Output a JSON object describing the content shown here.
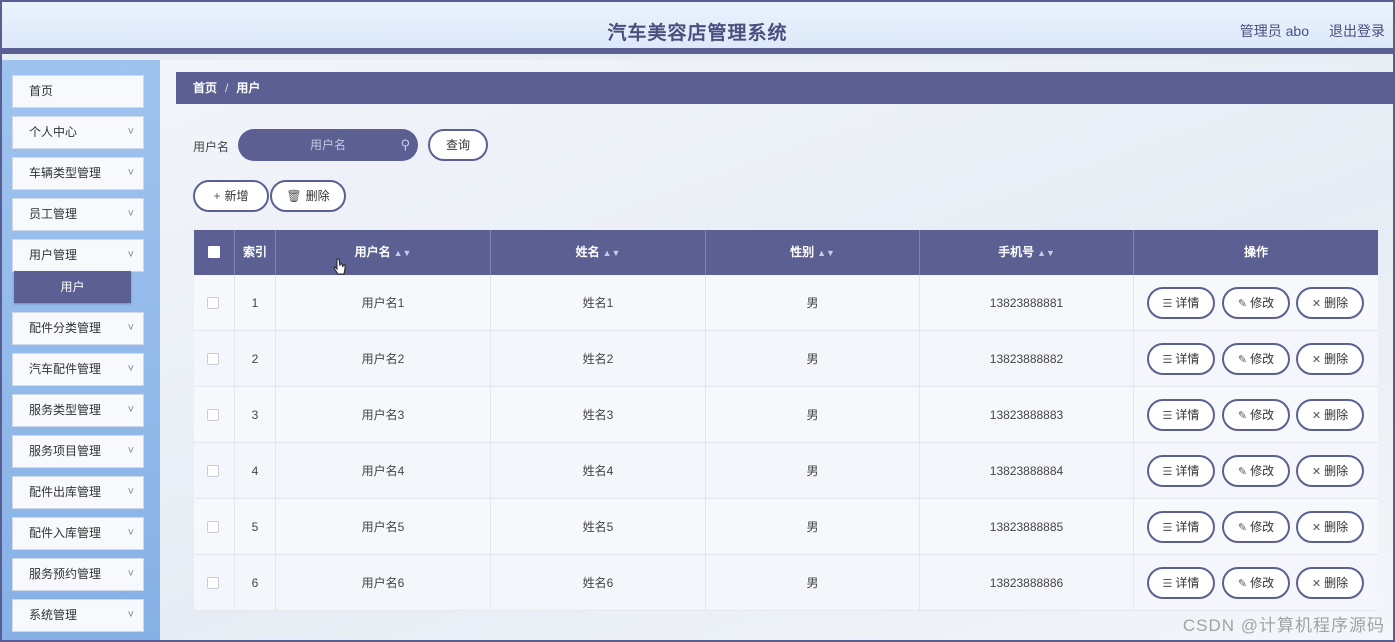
{
  "header": {
    "title": "汽车美容店管理系统",
    "user": "管理员 abo",
    "logout": "退出登录"
  },
  "sidebar": {
    "items": [
      {
        "label": "首页",
        "has_children": false
      },
      {
        "label": "个人中心",
        "has_children": true
      },
      {
        "label": "车辆类型管理",
        "has_children": true
      },
      {
        "label": "员工管理",
        "has_children": true
      },
      {
        "label": "用户管理",
        "has_children": true,
        "expanded": true
      },
      {
        "label": "配件分类管理",
        "has_children": true
      },
      {
        "label": "汽车配件管理",
        "has_children": true
      },
      {
        "label": "服务类型管理",
        "has_children": true
      },
      {
        "label": "服务项目管理",
        "has_children": true
      },
      {
        "label": "配件出库管理",
        "has_children": true
      },
      {
        "label": "配件入库管理",
        "has_children": true
      },
      {
        "label": "服务预约管理",
        "has_children": true
      },
      {
        "label": "系统管理",
        "has_children": true
      }
    ],
    "active_submenu": "用户",
    "chevron": "chevron-down-icon"
  },
  "breadcrumb": {
    "home": "首页",
    "sep": "/",
    "current": "用户"
  },
  "search": {
    "label": "用户名",
    "placeholder": "用户名",
    "button": "查询"
  },
  "toolbar": {
    "add": "新增",
    "delete": "删除"
  },
  "table": {
    "columns": [
      "索引",
      "用户名",
      "姓名",
      "性别",
      "手机号",
      "操作"
    ],
    "rows": [
      {
        "index": "1",
        "username": "用户名1",
        "name": "姓名1",
        "gender": "男",
        "phone": "13823888881"
      },
      {
        "index": "2",
        "username": "用户名2",
        "name": "姓名2",
        "gender": "男",
        "phone": "13823888882"
      },
      {
        "index": "3",
        "username": "用户名3",
        "name": "姓名3",
        "gender": "男",
        "phone": "13823888883"
      },
      {
        "index": "4",
        "username": "用户名4",
        "name": "姓名4",
        "gender": "男",
        "phone": "13823888884"
      },
      {
        "index": "5",
        "username": "用户名5",
        "name": "姓名5",
        "gender": "男",
        "phone": "13823888885"
      },
      {
        "index": "6",
        "username": "用户名6",
        "name": "姓名6",
        "gender": "男",
        "phone": "13823888886"
      }
    ],
    "actions": {
      "detail": "详情",
      "edit": "修改",
      "delete": "删除"
    }
  },
  "watermark": "CSDN @计算机程序源码",
  "colors": {
    "primary": "#5b5f92",
    "sidebar": "#9fc3ef"
  }
}
